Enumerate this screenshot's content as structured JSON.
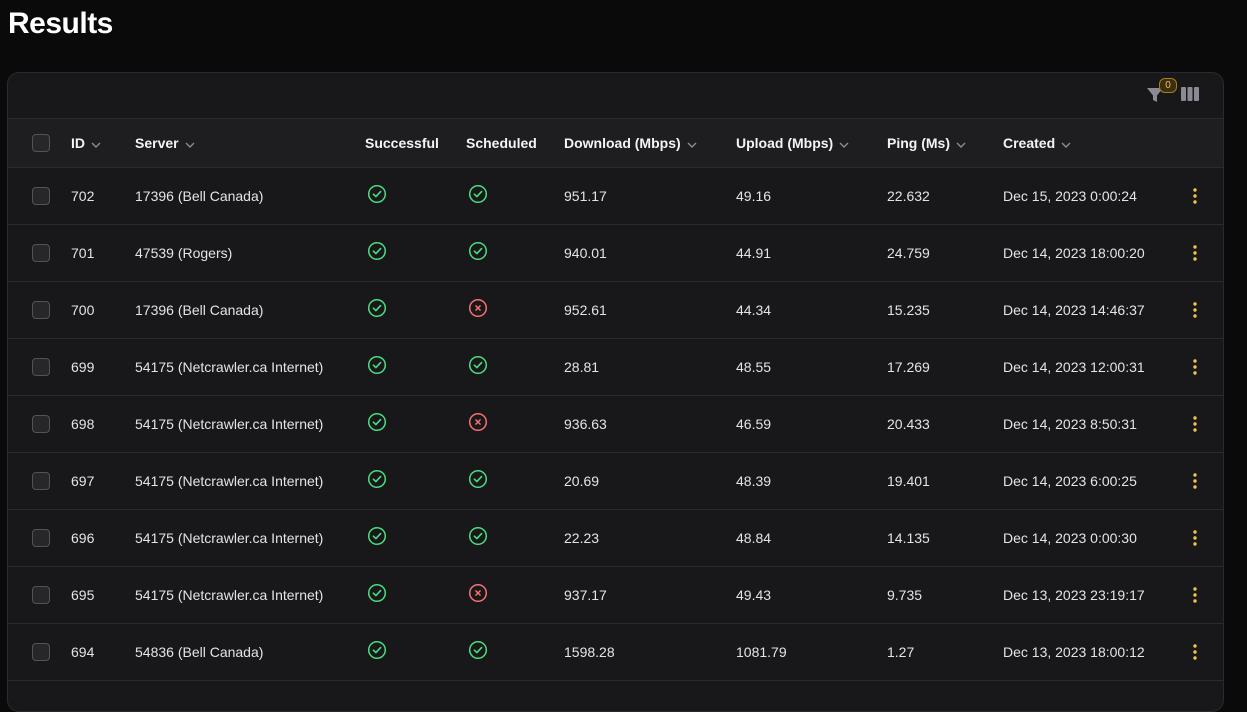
{
  "page": {
    "title": "Results"
  },
  "toolbar": {
    "filter_icon": "filter-icon",
    "filter_count": "0",
    "columns_icon": "columns-icon"
  },
  "colors": {
    "success": "#4ade80",
    "failure": "#f87171",
    "accent": "#f2c14e"
  },
  "table": {
    "headers": {
      "id": "ID",
      "server": "Server",
      "successful": "Successful",
      "scheduled": "Scheduled",
      "download": "Download (Mbps)",
      "upload": "Upload (Mbps)",
      "ping": "Ping (Ms)",
      "created": "Created"
    },
    "rows": [
      {
        "id": "702",
        "server": "17396 (Bell Canada)",
        "successful": true,
        "scheduled": true,
        "download": "951.17",
        "upload": "49.16",
        "ping": "22.632",
        "created": "Dec 15, 2023 0:00:24"
      },
      {
        "id": "701",
        "server": "47539 (Rogers)",
        "successful": true,
        "scheduled": true,
        "download": "940.01",
        "upload": "44.91",
        "ping": "24.759",
        "created": "Dec 14, 2023 18:00:20"
      },
      {
        "id": "700",
        "server": "17396 (Bell Canada)",
        "successful": true,
        "scheduled": false,
        "download": "952.61",
        "upload": "44.34",
        "ping": "15.235",
        "created": "Dec 14, 2023 14:46:37"
      },
      {
        "id": "699",
        "server": "54175 (Netcrawler.ca Internet)",
        "successful": true,
        "scheduled": true,
        "download": "28.81",
        "upload": "48.55",
        "ping": "17.269",
        "created": "Dec 14, 2023 12:00:31"
      },
      {
        "id": "698",
        "server": "54175 (Netcrawler.ca Internet)",
        "successful": true,
        "scheduled": false,
        "download": "936.63",
        "upload": "46.59",
        "ping": "20.433",
        "created": "Dec 14, 2023 8:50:31"
      },
      {
        "id": "697",
        "server": "54175 (Netcrawler.ca Internet)",
        "successful": true,
        "scheduled": true,
        "download": "20.69",
        "upload": "48.39",
        "ping": "19.401",
        "created": "Dec 14, 2023 6:00:25"
      },
      {
        "id": "696",
        "server": "54175 (Netcrawler.ca Internet)",
        "successful": true,
        "scheduled": true,
        "download": "22.23",
        "upload": "48.84",
        "ping": "14.135",
        "created": "Dec 14, 2023 0:00:30"
      },
      {
        "id": "695",
        "server": "54175 (Netcrawler.ca Internet)",
        "successful": true,
        "scheduled": false,
        "download": "937.17",
        "upload": "49.43",
        "ping": "9.735",
        "created": "Dec 13, 2023 23:19:17"
      },
      {
        "id": "694",
        "server": "54836 (Bell Canada)",
        "successful": true,
        "scheduled": true,
        "download": "1598.28",
        "upload": "1081.79",
        "ping": "1.27",
        "created": "Dec 13, 2023 18:00:12"
      }
    ]
  }
}
